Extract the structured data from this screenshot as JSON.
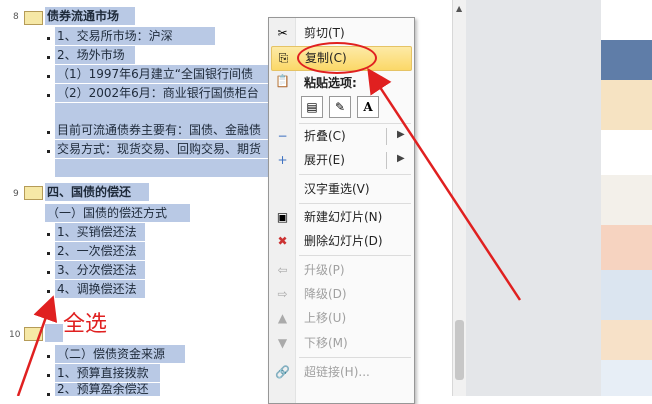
{
  "outline": {
    "slide8": {
      "num": "8",
      "title": "债券流通市场"
    },
    "items8": [
      "1、交易所市场：沪深",
      "2、场外市场",
      "（1）1997年6月建立“全国银行间债",
      "（2）2002年6月：商业银行国债柜台"
    ],
    "items8b": [
      "目前可流通债券主要有：国债、金融债",
      "交易方式：现货交易、回购交易、期货"
    ],
    "slide9": {
      "num": "9",
      "title": "四、国债的偿还"
    },
    "items9": [
      "（一）国债的偿还方式",
      "1、买销偿还法",
      "2、一次偿还法",
      "3、分次偿还法",
      "4、调换偿还法"
    ],
    "slide10": {
      "num": "10"
    },
    "items10": [
      "（二）偿债资金来源",
      "1、预算直接拨款",
      "2、预算盈余偿还"
    ]
  },
  "annotation": {
    "select_all": "全选"
  },
  "context_menu": {
    "cut": "剪切(T)",
    "copy": "复制(C)",
    "paste_options": "粘贴选项:",
    "paste_icons": [
      "keep-source-formatting-icon",
      "keep-text-only-icon",
      "text-A-icon"
    ],
    "paste_A": "A",
    "collapse": "折叠(C)",
    "expand": "展开(E)",
    "hanzi": "汉字重选(V)",
    "new_slide": "新建幻灯片(N)",
    "delete_slide": "删除幻灯片(D)",
    "promote": "升级(P)",
    "demote": "降级(D)",
    "move_up": "上移(U)",
    "move_down": "下移(M)",
    "hyperlink": "超链接(H)..."
  },
  "colors": {
    "selection": "#b9c9e5",
    "highlight": "#fbd868",
    "annotation": "#e02020"
  }
}
